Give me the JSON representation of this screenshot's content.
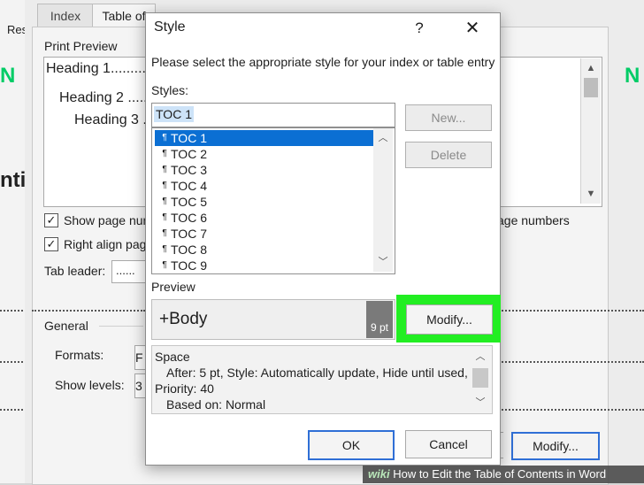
{
  "background_dialog": {
    "left_strip_text": "Res",
    "tabs": [
      "Index",
      "Table of"
    ],
    "doc_peek": [
      "N",
      "ntit"
    ],
    "print_preview_label": "Print Preview",
    "print_preview_lines": [
      "Heading 1..........",
      "Heading 2 ........",
      "Heading 3 ......"
    ],
    "right_peek_letter": "N",
    "show_page_numbers": "Show page num",
    "right_align": "Right align pag",
    "page_numbers_suffix": "age numbers",
    "tab_leader_label": "Tab leader:",
    "tab_leader_value": "......",
    "general_label": "General",
    "formats_label": "Formats:",
    "formats_value": "F",
    "show_levels_label": "Show levels:",
    "show_levels_value": "3",
    "modify_label": "Modify..."
  },
  "style_dialog": {
    "title": "Style",
    "help": "?",
    "close": "✕",
    "instruction": "Please select the appropriate style for your index or table entry",
    "styles_label": "Styles:",
    "styles_value": "TOC 1",
    "styles_list": [
      "TOC 1",
      "TOC 2",
      "TOC 3",
      "TOC 4",
      "TOC 5",
      "TOC 6",
      "TOC 7",
      "TOC 8",
      "TOC 9"
    ],
    "selected_index": 0,
    "new_label": "New...",
    "delete_label": "Delete",
    "preview_label": "Preview",
    "preview_text": "+Body",
    "preview_size": "9 pt",
    "modify_label": "Modify...",
    "description_lines": [
      "Space",
      "After:  5 pt, Style: Automatically update, Hide until used,",
      "Priority: 40",
      "Based on: Normal"
    ],
    "ok_label": "OK",
    "cancel_label": "Cancel"
  },
  "watermark": {
    "brand": "wiki",
    "text": "How to Edit the Table of Contents in Word"
  },
  "colors": {
    "highlight": "#22ee22",
    "selection": "#0b6fd3",
    "default_button_border": "#2f6fd6"
  }
}
